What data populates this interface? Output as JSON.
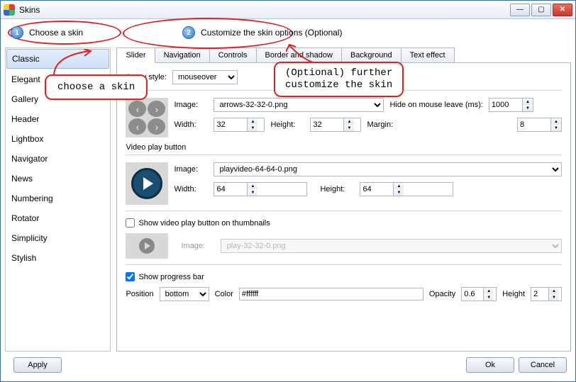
{
  "window": {
    "title": "Skins"
  },
  "steps": {
    "one_num": "1",
    "one_label": "Choose a skin",
    "two_num": "2",
    "two_label": "Customize the skin options (Optional)"
  },
  "annotations": {
    "callout1": "choose a skin",
    "callout2_line1": "(Optional) further",
    "callout2_line2": "customize the skin"
  },
  "skins": {
    "selected": "Classic",
    "items": [
      "Classic",
      "Elegant",
      "Gallery",
      "Header",
      "Lightbox",
      "Navigator",
      "News",
      "Numbering",
      "Rotator",
      "Simplicity",
      "Stylish"
    ]
  },
  "tabs": {
    "active": "Slider",
    "items": [
      "Slider",
      "Navigation",
      "Controls",
      "Border and shadow",
      "Background",
      "Text effect"
    ]
  },
  "slider": {
    "arrow_style_label": "Arrow style:",
    "arrow_style_value": "mouseover",
    "arrows": {
      "image_label": "Image:",
      "image_value": "arrows-32-32-0.png",
      "hide_leave_label": "Hide on mouse leave (ms):",
      "hide_leave_value": "1000",
      "width_label": "Width:",
      "width_value": "32",
      "height_label": "Height:",
      "height_value": "32",
      "margin_label": "Margin:",
      "margin_value": "8"
    },
    "video": {
      "title": "Video play button",
      "image_label": "Image:",
      "image_value": "playvideo-64-64-0.png",
      "width_label": "Width:",
      "width_value": "64",
      "height_label": "Height:",
      "height_value": "64"
    },
    "thumb_play": {
      "checkbox_label": "Show video play button on thumbnails",
      "checked": false,
      "image_label": "Image:",
      "image_value": "play-32-32-0.png"
    },
    "progress": {
      "checkbox_label": "Show progress bar",
      "checked": true,
      "position_label": "Position",
      "position_value": "bottom",
      "color_label": "Color",
      "color_value": "#ffffff",
      "opacity_label": "Opacity",
      "opacity_value": "0.6",
      "height_label": "Height",
      "height_value": "2"
    }
  },
  "footer": {
    "apply": "Apply",
    "ok": "Ok",
    "cancel": "Cancel"
  }
}
